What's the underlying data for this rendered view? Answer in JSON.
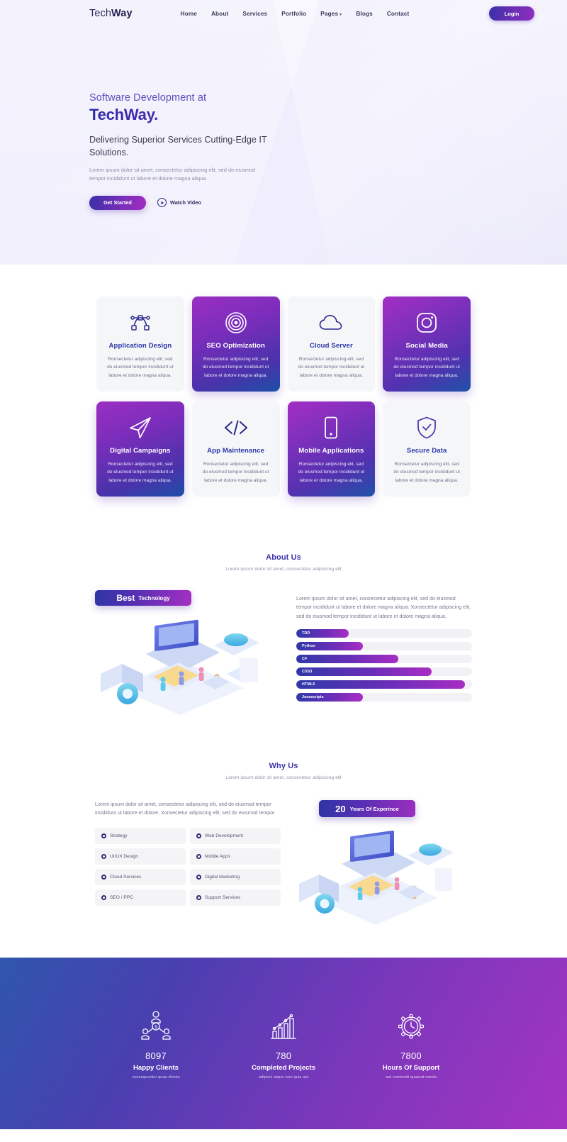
{
  "nav": {
    "logo_light": "Tech",
    "logo_bold": "Way",
    "links": [
      {
        "label": "Home"
      },
      {
        "label": "About"
      },
      {
        "label": "Services"
      },
      {
        "label": "Portfolio"
      },
      {
        "label": "Pages",
        "caret": "▾"
      },
      {
        "label": "Blogs"
      },
      {
        "label": "Contact"
      }
    ],
    "login_label": "Login"
  },
  "hero": {
    "pre_title": "Software Development at",
    "title": "TechWay.",
    "subtitle": "Delivering Superior Services Cutting-Edge IT Solutions.",
    "description": "Lorem ipsum dolor sit amet, consectetur adipiscing elit, sed do eiusmod tempor incididunt ut labore et dolore magna aliqua.",
    "primary_button": "Get Started",
    "video_label": "Watch Video"
  },
  "services": {
    "card_text": "Ronsectetur adipiscing elit, sed do elusmod tempor incididunt ut labore et dolore magna aliqua.",
    "cards": [
      {
        "title": "Application Design",
        "icon": "nodes-icon",
        "style": "light"
      },
      {
        "title": "SEO Optimization",
        "icon": "target-icon",
        "style": "grad"
      },
      {
        "title": "Cloud Server",
        "icon": "cloud-icon",
        "style": "light"
      },
      {
        "title": "Social Media",
        "icon": "instagram-icon",
        "style": "grad"
      },
      {
        "title": "Digital Campaigns",
        "icon": "send-icon",
        "style": "grad"
      },
      {
        "title": "App Maintenance",
        "icon": "code-icon",
        "style": "light"
      },
      {
        "title": "Mobile Applications",
        "icon": "mobile-icon",
        "style": "grad"
      },
      {
        "title": "Secure Data",
        "icon": "shield-check-icon",
        "style": "light"
      }
    ]
  },
  "about": {
    "section_title": "About Us",
    "section_subtitle": "Lorem ipsum dolor sit amet, consectetur adipiscing elit",
    "badge_strong": "Best",
    "badge_light": "Technology",
    "paragraph": "Lorem ipsum dolor sit amet, consectetur adipiscing elit, sed do eiusmod tempor incididunt ut labore et dolore magna aliqua. Xonsectetur adipiscing elit, sed do eiusmod tempor incididunt ut labore et dolore magna aliqua.",
    "skills": [
      {
        "label": "TDD",
        "percent": 30
      },
      {
        "label": "Python",
        "percent": 38
      },
      {
        "label": "C#",
        "percent": 58
      },
      {
        "label": "CSS3",
        "percent": 77
      },
      {
        "label": "HTML5",
        "percent": 96
      },
      {
        "label": "Javascripts",
        "percent": 38
      }
    ]
  },
  "why": {
    "section_title": "Why Us",
    "section_subtitle": "Lorem ipsum dolor sit amet, consectetur adipiscing elit",
    "paragraph": "Lorem ipsum dolor sit amet, consectetur adipiscing elit, sed do eiusmod tempor incididunt ut labore et dolore. Xonsectetur adipiscing elit, sed do eiusmod tempor",
    "items": [
      {
        "label": "Strategy"
      },
      {
        "label": "Web Development"
      },
      {
        "label": "UI/UX Design"
      },
      {
        "label": "Mobile Apps"
      },
      {
        "label": "Cloud Services"
      },
      {
        "label": "Digital Marketing"
      },
      {
        "label": "SEO / PPC"
      },
      {
        "label": "Support Services"
      }
    ],
    "badge_number": "20",
    "badge_text": "Years Of Experince"
  },
  "stats": [
    {
      "number": "8097",
      "label": "Happy Clients",
      "note": "consequuntur quae diredo",
      "icon": "network-users-icon"
    },
    {
      "number": "780",
      "label": "Completed Projects",
      "note": "adipisci atque cum quia aut",
      "icon": "bar-chart-growth-icon"
    },
    {
      "number": "7800",
      "label": "Hours Of Support",
      "note": "aut commodi quaerat mesta",
      "icon": "gear-clock-icon"
    }
  ],
  "colors": {
    "brand_purple": "#8e2fc0",
    "brand_indigo": "#3b2fa8",
    "heading_blue": "#3b33a8",
    "muted_text": "#76768e"
  }
}
